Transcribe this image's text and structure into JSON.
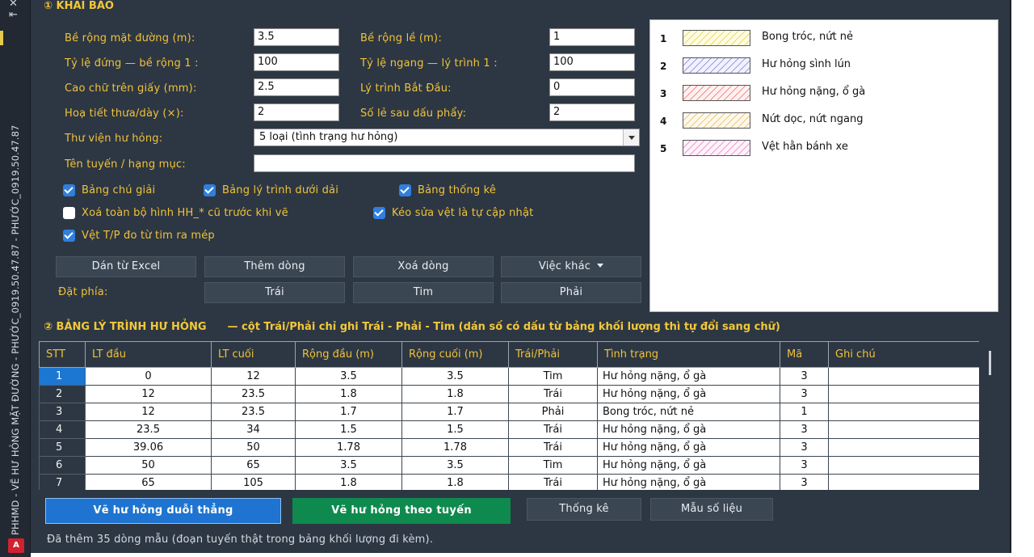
{
  "sidebar": {
    "vertical_text": "PHHMD - VẼ HƯ HỎNG MẶT ĐƯỜNG - PHƯỚC_0919.50.47.87 - PHƯỚC_0919.50.47.87",
    "app_badge": "A"
  },
  "section1": {
    "title": "① KHAI BÁO"
  },
  "form": {
    "road_width_label": "Bề rộng mặt đường (m):",
    "road_width_value": "3.5",
    "shoulder_width_label": "Bề rộng lề (m):",
    "shoulder_width_value": "1",
    "vscale_label": "Tỷ lệ đứng — bề rộng   1 :",
    "vscale_value": "100",
    "hscale_label": "Tỷ lệ ngang — lý trình   1 :",
    "hscale_value": "100",
    "text_height_label": "Cao chữ trên giấy (mm):",
    "text_height_value": "2.5",
    "start_station_label": "Lý trình Bắt Đầu:",
    "start_station_value": "0",
    "hatch_label": "Hoạ tiết thưa/dày (×):",
    "hatch_value": "2",
    "decimals_label": "Số lẻ sau dấu phẩy:",
    "decimals_value": "2",
    "library_label": "Thư viện hư hỏng:",
    "library_value": "5 loại (tình trạng hư hỏng)",
    "route_label": "Tên tuyến / hạng mục:",
    "route_value": ""
  },
  "checks": {
    "legend": "Bảng chú giải",
    "station_table": "Bảng lý trình dưới dải",
    "stats": "Bảng thống kê",
    "clear_old": "Xoá toàn bộ hình HH_* cũ trước khi vẽ",
    "auto_update": "Kéo sửa vệt là tự cập nhật",
    "lr_from_center": "Vệt T/P đo từ tim ra mép"
  },
  "buttons": {
    "paste_excel": "Dán từ Excel",
    "add_row": "Thêm dòng",
    "delete_row": "Xoá dòng",
    "more": "Việc khác",
    "side_label": "Đặt phía:",
    "left": "Trái",
    "center": "Tim",
    "right": "Phải",
    "draw_straight": "Vẽ hư hỏng duỗi thẳng",
    "draw_route": "Vẽ hư hỏng theo tuyến",
    "statistics": "Thống kê",
    "sample_data": "Mẫu số liệu"
  },
  "legend": [
    {
      "num": "1",
      "name": "Bong tróc, nứt nẻ",
      "color": "#c8b400",
      "fill": "#fffbe0"
    },
    {
      "num": "2",
      "name": "Hư hỏng sình lún",
      "color": "#3a3ab8",
      "fill": "#f1f1ff"
    },
    {
      "num": "3",
      "name": "Hư hỏng nặng, ổ gà",
      "color": "#e01818",
      "fill": "#fff0f0"
    },
    {
      "num": "4",
      "name": "Nứt dọc, nứt ngang",
      "color": "#d28c00",
      "fill": "#fff8ea"
    },
    {
      "num": "5",
      "name": "Vệt hằn bánh xe",
      "color": "#cc3a9a",
      "fill": "#fff2fa"
    }
  ],
  "section2": {
    "title": "② BẢNG LÝ TRÌNH HƯ HỎNG",
    "note": "— cột Trái/Phải chỉ ghi  Trái - Phải - Tim  (dán số có dấu từ bảng khối lượng thì tự đổi sang chữ)"
  },
  "table": {
    "columns": [
      "STT",
      "LT đầu",
      "LT cuối",
      "Rộng đầu (m)",
      "Rộng cuối (m)",
      "Trái/Phải",
      "Tình trạng",
      "Mã",
      "Ghi chú"
    ],
    "rows": [
      [
        "1",
        "0",
        "12",
        "3.5",
        "3.5",
        "Tim",
        "Hư hỏng nặng, ổ gà",
        "3",
        ""
      ],
      [
        "2",
        "12",
        "23.5",
        "1.8",
        "1.8",
        "Trái",
        "Hư hỏng nặng, ổ gà",
        "3",
        ""
      ],
      [
        "3",
        "12",
        "23.5",
        "1.7",
        "1.7",
        "Phải",
        "Bong tróc, nứt nẻ",
        "1",
        ""
      ],
      [
        "4",
        "23.5",
        "34",
        "1.5",
        "1.5",
        "Trái",
        "Hư hỏng nặng, ổ gà",
        "3",
        ""
      ],
      [
        "5",
        "39.06",
        "50",
        "1.78",
        "1.78",
        "Trái",
        "Hư hỏng nặng, ổ gà",
        "3",
        ""
      ],
      [
        "6",
        "50",
        "65",
        "3.5",
        "3.5",
        "Tim",
        "Hư hỏng nặng, ổ gà",
        "3",
        ""
      ],
      [
        "7",
        "65",
        "105",
        "1.8",
        "1.8",
        "Trái",
        "Hư hỏng nặng, ổ gà",
        "3",
        ""
      ]
    ]
  },
  "status": "Đã thêm 35 dòng mẫu (đoạn tuyến thật trong bảng khối lượng đi kèm).",
  "colors": {
    "panel": "#2d3743",
    "accent": "#f0c23a",
    "blue": "#1e74d0",
    "green": "#0f8a4f"
  }
}
